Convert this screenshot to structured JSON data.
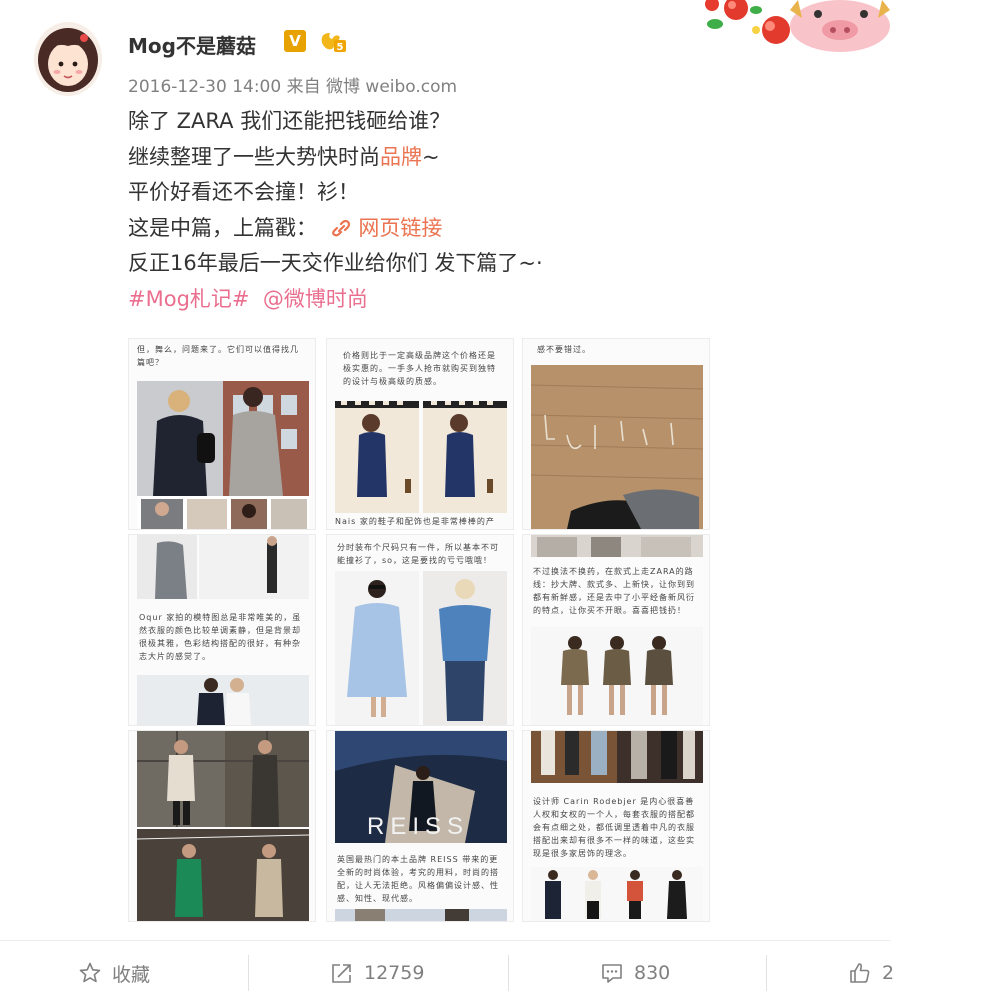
{
  "post": {
    "username": "Mog不是蘑菇",
    "verified_badge": "V",
    "level_badge": "5",
    "timestamp": "2016-12-30 14:00",
    "source": "来自 微博 weibo.com",
    "lines": {
      "l1": "除了 ZARA 我们还能把钱砸给谁？",
      "l2_a": "继续整理了一些大势快时尚",
      "l2_link": "品牌",
      "l2_b": "~",
      "l3": "平价好看还不会撞！衫！",
      "l4_a": "这是中篇，上篇戳：",
      "l4_link": "网页链接",
      "l5": "反正16年最后一天交作业给你们 发下篇了~·",
      "tag": "#Mog札记#",
      "mention": "@微博时尚"
    }
  },
  "grid": {
    "t1_cap": "但，舞么，问题来了。它们可以值得找几篇吧？",
    "t2_cap_top": "价格则比于一定高级品牌这个价格还是极实惠的。一手多人抢市就购买到独特的设计与极高级的质感。",
    "t2_cap_bottom": "Nais 家的鞋子和配饰也是非常棒棒的产",
    "t3_cap": "感不要错过。",
    "t4_cap": "Oqur 家拍的模特图总是非常唯美的，虽然衣服的颜色比较单调素静，但是背景却很极其雅，色彩结构搭配的很好，有种杂志大片的感觉了。",
    "t5_cap": "分时装布个尺码只有一件，所以基本不可能撞衫了，so，这是要找的亏亏哦哦！",
    "t6_cap": "不过换法不换药，在款式上走ZARA的路线：抄大牌、款式多、上新快，让你到到都有新鲜感，还是去中了小平经备新风衍的特点，让你买不开眼。喜喜把钱扔！",
    "t8_brand": "REISS",
    "t8_cap": "英国最热门的本土品牌 REISS 带来的更全新的时尚体验，考究的用料，时尚的搭配，让人无法拒绝。风格偏偏设计感、性感、知性、现代感。",
    "t9_cap": "设计师 Carin Rodebjer 是内心很喜善人权和女权的一个人，每套衣服的搭配都会有点细之处，都低调里透着中凡的衣服搭配出来却有很多不一样的味道，这些实现是很多家居饰的理念。"
  },
  "footer": {
    "favorite_label": "收藏",
    "repost_count": "12759",
    "comment_count": "830",
    "like_count": "2"
  },
  "colors": {
    "link": "#eb7350",
    "topic": "#ea6f8f",
    "meta_text": "#808080",
    "verified": "#e8a200"
  }
}
